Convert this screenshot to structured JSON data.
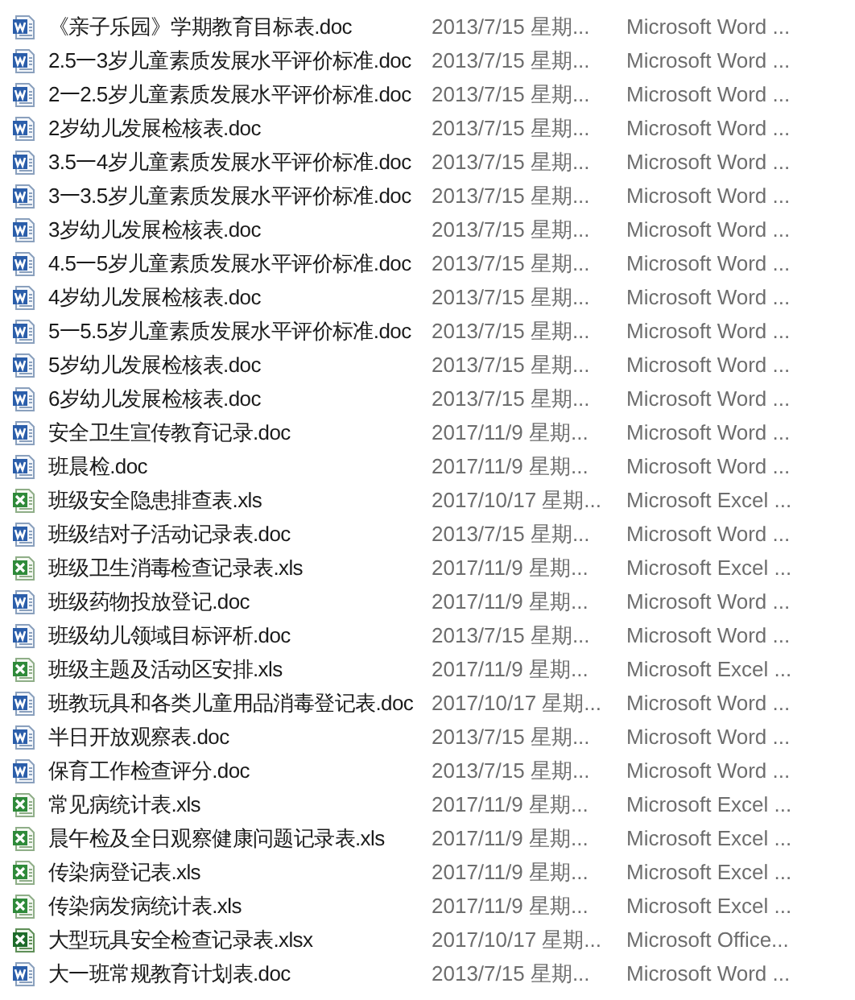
{
  "files": [
    {
      "name": "《亲子乐园》学期教育目标表.doc",
      "modified": "2013/7/15 星期...",
      "type": "Microsoft Word ...",
      "kind": "word"
    },
    {
      "name": "2.5一3岁儿童素质发展水平评价标准.doc",
      "modified": "2013/7/15 星期...",
      "type": "Microsoft Word ...",
      "kind": "word"
    },
    {
      "name": "2一2.5岁儿童素质发展水平评价标准.doc",
      "modified": "2013/7/15 星期...",
      "type": "Microsoft Word ...",
      "kind": "word"
    },
    {
      "name": "2岁幼儿发展检核表.doc",
      "modified": "2013/7/15 星期...",
      "type": "Microsoft Word ...",
      "kind": "word"
    },
    {
      "name": "3.5一4岁儿童素质发展水平评价标准.doc",
      "modified": "2013/7/15 星期...",
      "type": "Microsoft Word ...",
      "kind": "word"
    },
    {
      "name": "3一3.5岁儿童素质发展水平评价标准.doc",
      "modified": "2013/7/15 星期...",
      "type": "Microsoft Word ...",
      "kind": "word"
    },
    {
      "name": "3岁幼儿发展检核表.doc",
      "modified": "2013/7/15 星期...",
      "type": "Microsoft Word ...",
      "kind": "word"
    },
    {
      "name": "4.5一5岁儿童素质发展水平评价标准.doc",
      "modified": "2013/7/15 星期...",
      "type": "Microsoft Word ...",
      "kind": "word"
    },
    {
      "name": "4岁幼儿发展检核表.doc",
      "modified": "2013/7/15 星期...",
      "type": "Microsoft Word ...",
      "kind": "word"
    },
    {
      "name": "5一5.5岁儿童素质发展水平评价标准.doc",
      "modified": "2013/7/15 星期...",
      "type": "Microsoft Word ...",
      "kind": "word"
    },
    {
      "name": "5岁幼儿发展检核表.doc",
      "modified": "2013/7/15 星期...",
      "type": "Microsoft Word ...",
      "kind": "word"
    },
    {
      "name": "6岁幼儿发展检核表.doc",
      "modified": "2013/7/15 星期...",
      "type": "Microsoft Word ...",
      "kind": "word"
    },
    {
      "name": "安全卫生宣传教育记录.doc",
      "modified": "2017/11/9 星期...",
      "type": "Microsoft Word ...",
      "kind": "word"
    },
    {
      "name": "班晨检.doc",
      "modified": "2017/11/9 星期...",
      "type": "Microsoft Word ...",
      "kind": "word"
    },
    {
      "name": "班级安全隐患排查表.xls",
      "modified": "2017/10/17 星期...",
      "type": "Microsoft Excel ...",
      "kind": "excel"
    },
    {
      "name": "班级结对子活动记录表.doc",
      "modified": "2013/7/15 星期...",
      "type": "Microsoft Word ...",
      "kind": "word"
    },
    {
      "name": "班级卫生消毒检查记录表.xls",
      "modified": "2017/11/9 星期...",
      "type": "Microsoft Excel ...",
      "kind": "excel"
    },
    {
      "name": "班级药物投放登记.doc",
      "modified": "2017/11/9 星期...",
      "type": "Microsoft Word ...",
      "kind": "word"
    },
    {
      "name": "班级幼儿领域目标评析.doc",
      "modified": "2013/7/15 星期...",
      "type": "Microsoft Word ...",
      "kind": "word"
    },
    {
      "name": "班级主题及活动区安排.xls",
      "modified": "2017/11/9 星期...",
      "type": "Microsoft Excel ...",
      "kind": "excel"
    },
    {
      "name": "班教玩具和各类儿童用品消毒登记表.doc",
      "modified": "2017/10/17 星期...",
      "type": "Microsoft Word ...",
      "kind": "word"
    },
    {
      "name": "半日开放观察表.doc",
      "modified": "2013/7/15 星期...",
      "type": "Microsoft Word ...",
      "kind": "word"
    },
    {
      "name": "保育工作检查评分.doc",
      "modified": "2013/7/15 星期...",
      "type": "Microsoft Word ...",
      "kind": "word"
    },
    {
      "name": "常见病统计表.xls",
      "modified": "2017/11/9 星期...",
      "type": "Microsoft Excel ...",
      "kind": "excel"
    },
    {
      "name": "晨午检及全日观察健康问题记录表.xls",
      "modified": "2017/11/9 星期...",
      "type": "Microsoft Excel ...",
      "kind": "excel"
    },
    {
      "name": "传染病登记表.xls",
      "modified": "2017/11/9 星期...",
      "type": "Microsoft Excel ...",
      "kind": "excel"
    },
    {
      "name": "传染病发病统计表.xls",
      "modified": "2017/11/9 星期...",
      "type": "Microsoft Excel ...",
      "kind": "excel"
    },
    {
      "name": "大型玩具安全检查记录表.xlsx",
      "modified": "2017/10/17 星期...",
      "type": "Microsoft Office...",
      "kind": "excelx"
    },
    {
      "name": "大一班常规教育计划表.doc",
      "modified": "2013/7/15 星期...",
      "type": "Microsoft Word ...",
      "kind": "word"
    }
  ]
}
